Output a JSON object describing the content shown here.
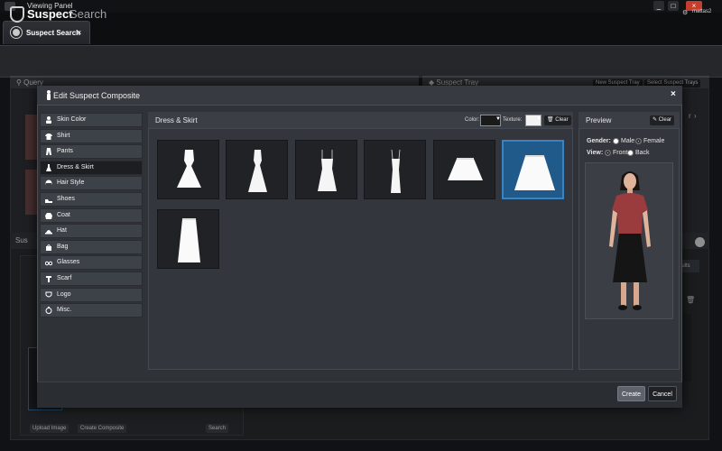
{
  "window": {
    "title": "Viewing Panel",
    "controls": [
      "_",
      "□",
      "×"
    ]
  },
  "tab": {
    "label": "Suspect Search",
    "close": "×"
  },
  "app": {
    "logo_part1": "Suspect",
    "logo_part2": "Search",
    "user_gear": "⚙",
    "user_name": "mattas2"
  },
  "background": {
    "query_label": "Query",
    "tray_label": "Suspect Tray",
    "new_tray": "New Suspect Tray",
    "select_trays": "Select Suspect Trays",
    "lower_label": "Sus",
    "results_label": "ults",
    "upload_image": "Upload Image",
    "create_composite": "Create Composite",
    "search": "Search",
    "next_label": "r",
    "next_arrow": "›"
  },
  "modal": {
    "title": "Edit Suspect Composite",
    "close": "×",
    "create": "Create",
    "cancel": "Cancel"
  },
  "categories": [
    {
      "label": "Skin Color",
      "icon": "person-icon"
    },
    {
      "label": "Shirt",
      "icon": "shirt-icon"
    },
    {
      "label": "Pants",
      "icon": "pants-icon"
    },
    {
      "label": "Dress & Skirt",
      "icon": "dress-icon",
      "active": true
    },
    {
      "label": "Hair Style",
      "icon": "hair-icon"
    },
    {
      "label": "Shoes",
      "icon": "shoe-icon"
    },
    {
      "label": "Coat",
      "icon": "coat-icon"
    },
    {
      "label": "Hat",
      "icon": "hat-icon"
    },
    {
      "label": "Bag",
      "icon": "bag-icon"
    },
    {
      "label": "Glasses",
      "icon": "glasses-icon"
    },
    {
      "label": "Scarf",
      "icon": "scarf-icon"
    },
    {
      "label": "Logo",
      "icon": "shield-icon"
    },
    {
      "label": "Misc.",
      "icon": "misc-icon"
    }
  ],
  "items_panel": {
    "title": "Dress & Skirt",
    "color_label": "Color:",
    "texture_label": "Texture:",
    "clear": "Clear",
    "selected_color": "#1a1a1a",
    "selected_texture": "#f3f3f3",
    "items": [
      {
        "name": "dress-sleeveless-flare"
      },
      {
        "name": "dress-aline-long"
      },
      {
        "name": "dress-strap-short"
      },
      {
        "name": "dress-strap-long"
      },
      {
        "name": "skirt-short"
      },
      {
        "name": "skirt-midi",
        "selected": true
      },
      {
        "name": "skirt-long"
      }
    ]
  },
  "preview": {
    "title": "Preview",
    "clear": "Clear",
    "gender_label": "Gender:",
    "gender_options": [
      "Male",
      "Female"
    ],
    "gender_selected": "Female",
    "view_label": "View:",
    "view_options": [
      "Front",
      "Back"
    ],
    "view_selected": "Front",
    "shirt_color": "#9a3b3e",
    "skirt_color": "#151515"
  }
}
